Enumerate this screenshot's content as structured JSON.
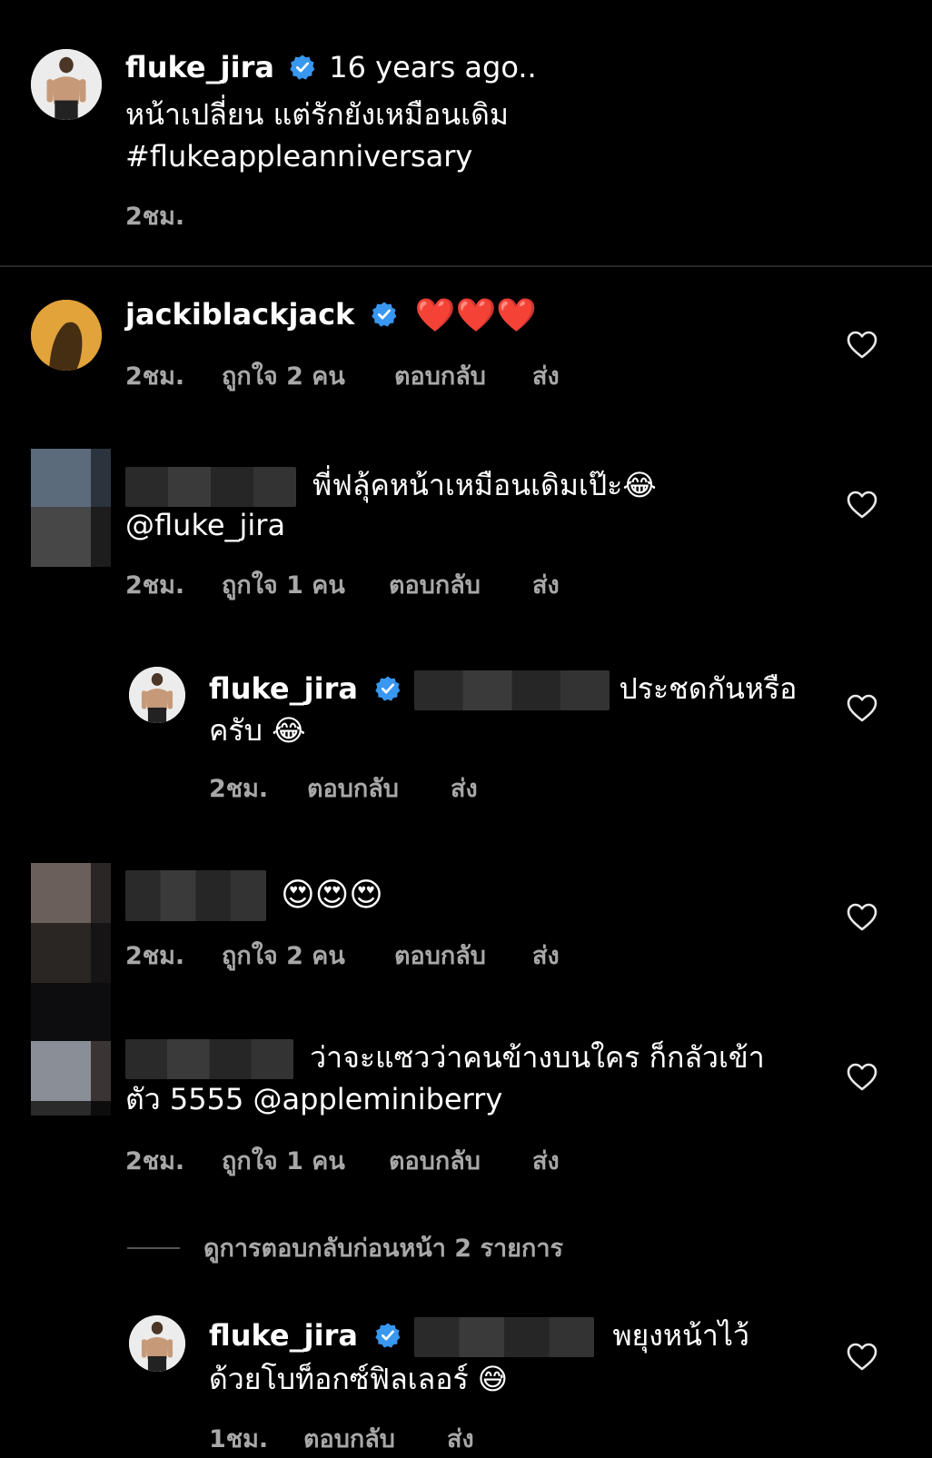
{
  "caption": {
    "username": "fluke_jira",
    "line1": "16 years ago..",
    "line2": "หน้าเปลี่ยน แต่รักยังเหมือนเดิม",
    "hashtag": "#flukeappleanniversary",
    "time": "2ชม."
  },
  "comments": [
    {
      "username": "jackiblackjack",
      "text": "❤️❤️❤️",
      "time": "2ชม.",
      "likes": "ถูกใจ 2 คน",
      "reply": "ตอบกลับ",
      "send": "ส่ง"
    },
    {
      "text_line1": "พี่ฟลุ้คหน้าเหมือนเดิมเป๊ะ😂",
      "text_line2": "@fluke_jira",
      "time": "2ชม.",
      "likes": "ถูกใจ 1 คน",
      "reply": "ตอบกลับ",
      "send": "ส่ง"
    },
    {
      "username": "fluke_jira",
      "text_line1": "ประชดกันหรือ",
      "text_line2": "ครับ 😂",
      "time": "2ชม.",
      "reply": "ตอบกลับ",
      "send": "ส่ง"
    },
    {
      "text": "😍😍😍",
      "time": "2ชม.",
      "likes": "ถูกใจ 2 คน",
      "reply": "ตอบกลับ",
      "send": "ส่ง"
    },
    {
      "text_line1": "ว่าจะแซวว่าคนข้างบนใคร ก็กลัวเข้า",
      "text_line2": "ตัว 5555 @appleminiberry",
      "time": "2ชม.",
      "likes": "ถูกใจ 1 คน",
      "reply": "ตอบกลับ",
      "send": "ส่ง"
    },
    {
      "username": "fluke_jira",
      "text_line1": "พยุงหน้าไว้",
      "text_line2": "ด้วยโบท็อกซ์ฟิลเลอร์ 😅",
      "time": "1ชม.",
      "reply": "ตอบกลับ",
      "send": "ส่ง"
    }
  ],
  "view_previous": "ดูการตอบกลับก่อนหน้า 2 รายการ",
  "colors": {
    "background": "#000000",
    "meta": "#a8a8a8",
    "verified": "#3897f0"
  },
  "icons": [
    "verified-badge-icon",
    "heart-outline-icon"
  ]
}
